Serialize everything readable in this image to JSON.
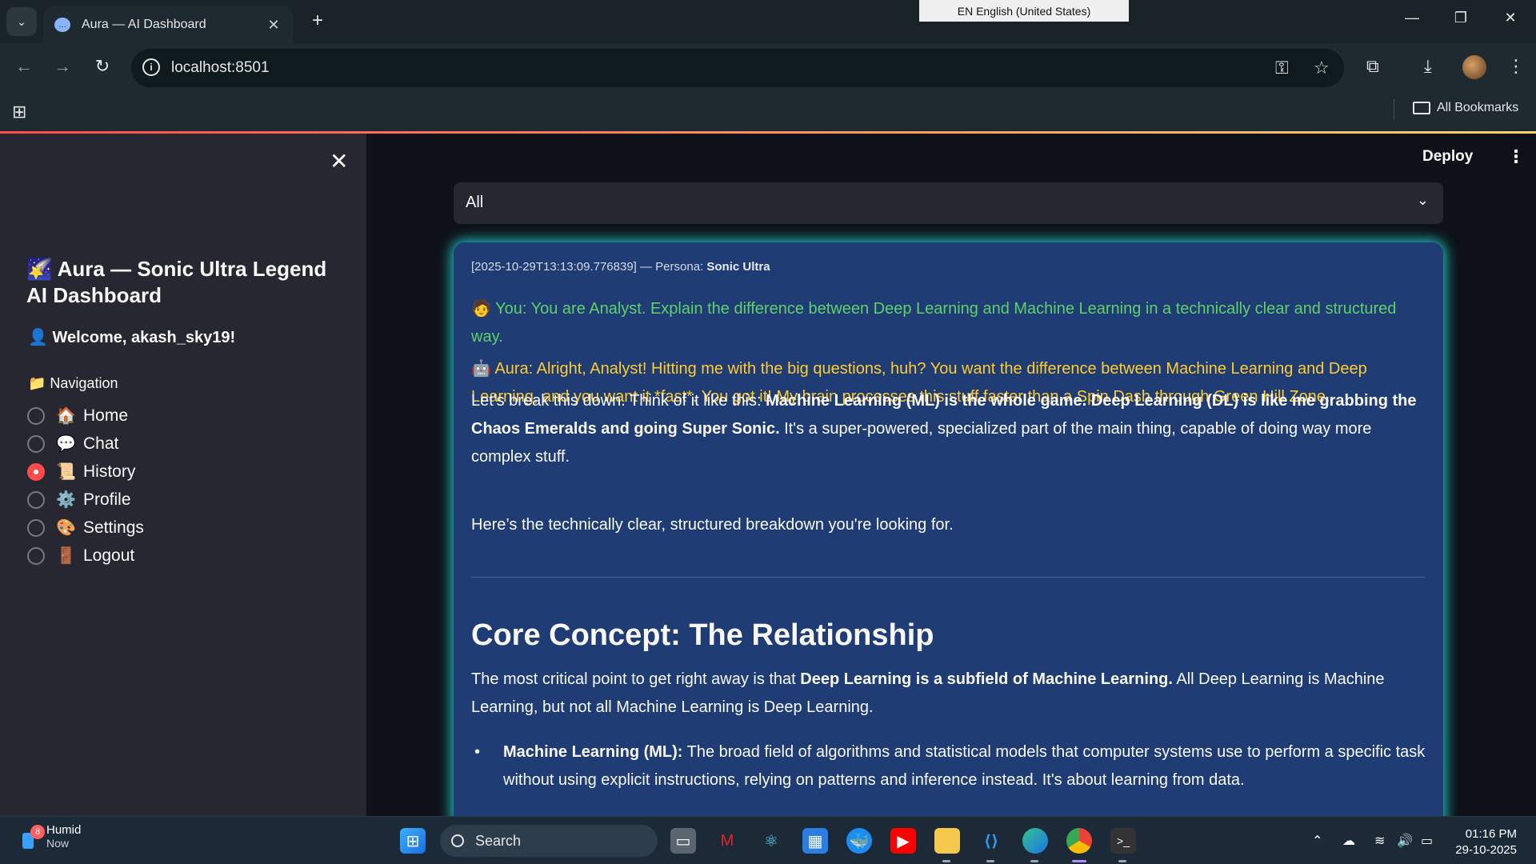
{
  "browser": {
    "tab_title": "Aura — AI Dashboard",
    "url": "localhost:8501",
    "language_bar": "EN English (United States)",
    "bookmarks_label": "All Bookmarks"
  },
  "sidebar": {
    "title": "🌠 Aura — Sonic Ultra Legend AI Dashboard",
    "welcome": "👤 Welcome, akash_sky19!",
    "nav_label": "📁 Navigation",
    "items": [
      {
        "icon": "🏠",
        "label": "Home",
        "selected": false
      },
      {
        "icon": "💬",
        "label": "Chat",
        "selected": false
      },
      {
        "icon": "📜",
        "label": "History",
        "selected": true
      },
      {
        "icon": "⚙️",
        "label": "Profile",
        "selected": false
      },
      {
        "icon": "🎨",
        "label": "Settings",
        "selected": false
      },
      {
        "icon": "🚪",
        "label": "Logout",
        "selected": false
      }
    ]
  },
  "header": {
    "deploy_label": "Deploy"
  },
  "filter": {
    "selected": "All"
  },
  "entry": {
    "timestamp": "[2025-10-29T13:13:09.776839] — Persona:",
    "persona": "Sonic Ultra",
    "you_message": "🧑 You: You are Analyst. Explain the difference between Deep Learning and Machine Learning in a technically clear and structured way.",
    "aura_message": "🤖 Aura: Alright, Analyst! Hitting me with the big questions, huh? You want the difference between Machine Learning and Deep Learning, and you want it *fast*. You got it! My brain processes this stuff faster than a Spin Dash through Green Hill Zone.",
    "p1_a": "Let's break this down. Think of it like this: ",
    "p1_b": "Machine Learning (ML) is the whole game. Deep Learning (DL) is like me grabbing the Chaos Emeralds and going Super Sonic.",
    "p1_c": " It's a super-powered, specialized part of the main thing, capable of doing way more complex stuff.",
    "p2": "Here’s the technically clear, structured breakdown you're looking for.",
    "heading": "Core Concept: The Relationship",
    "p3_a": "The most critical point to get right away is that ",
    "p3_b": "Deep Learning is a subfield of Machine Learning.",
    "p3_c": " All Deep Learning is Machine Learning, but not all Machine Learning is Deep Learning.",
    "bullet_b": "Machine Learning (ML):",
    "bullet_t": " The broad field of algorithms and statistical models that computer systems use to perform a specific task without using explicit instructions, relying on patterns and inference instead. It's about learning from data."
  },
  "taskbar": {
    "weather_badge": "8",
    "weather_title": "Humid",
    "weather_sub": "Now",
    "search_label": "Search",
    "time": "01:16 PM",
    "date": "29-10-2025"
  }
}
